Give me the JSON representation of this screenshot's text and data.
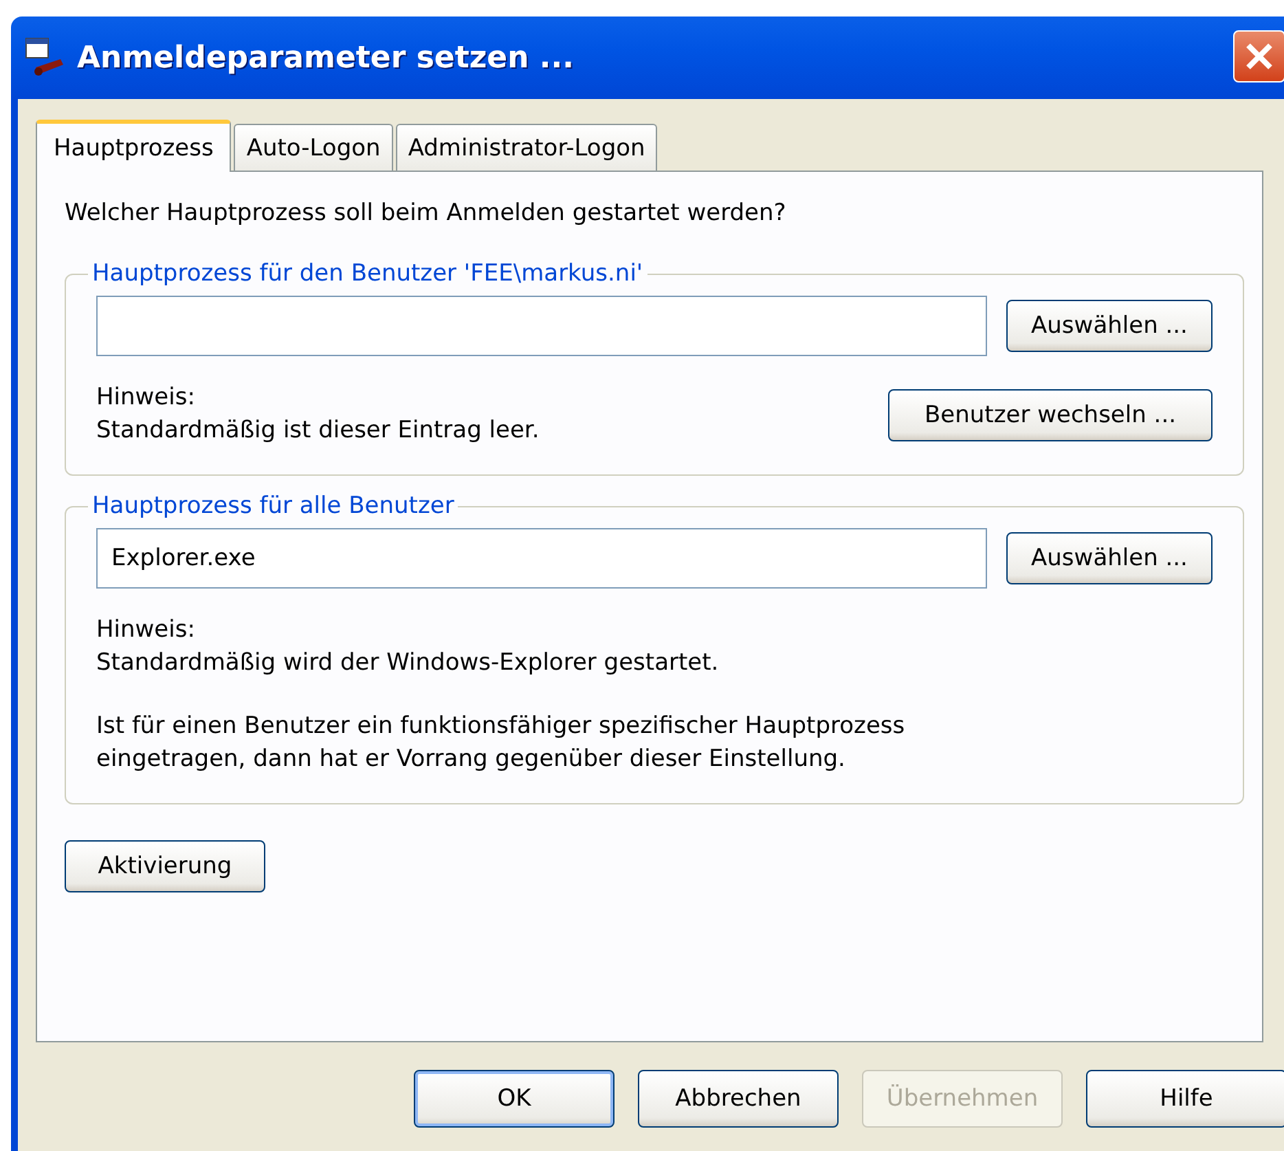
{
  "window": {
    "title": "Anmeldeparameter setzen ..."
  },
  "tabs": [
    {
      "label": "Hauptprozess",
      "selected": true
    },
    {
      "label": "Auto-Logon",
      "selected": false
    },
    {
      "label": "Administrator-Logon",
      "selected": false
    }
  ],
  "question": "Welcher Hauptprozess soll beim Anmelden gestartet werden?",
  "groups": [
    {
      "title": "Hauptprozess für den Benutzer 'FEE\\markus.ni'",
      "browse_button": "Auswählen ...",
      "notes": [
        [
          "Hinweis:",
          "Standardmäßig ist dieser Eintrag leer."
        ]
      ],
      "switch_button": "Benutzer wechseln ..."
    },
    {
      "title": "Hauptprozess für alle Benutzer",
      "field": {
        "value": "Explorer.exe"
      },
      "browse_button": "Auswählen ...",
      "notes": [
        [
          "Hinweis:",
          "Standardmäßig wird der Windows-Explorer gestartet."
        ],
        [
          "Ist für einen Benutzer ein funktionsfähiger spezifischer Hauptprozess",
          "eingetragen, dann hat er Vorrang gegenüber dieser Einstellung."
        ]
      ]
    }
  ],
  "activation_button": "Aktivierung",
  "buttons": [
    {
      "label": "OK",
      "default": true,
      "disabled": false
    },
    {
      "label": "Abbrechen",
      "default": false,
      "disabled": false
    },
    {
      "label": "Übernehmen",
      "default": false,
      "disabled": true
    },
    {
      "label": "Hilfe",
      "default": false,
      "disabled": false
    }
  ]
}
